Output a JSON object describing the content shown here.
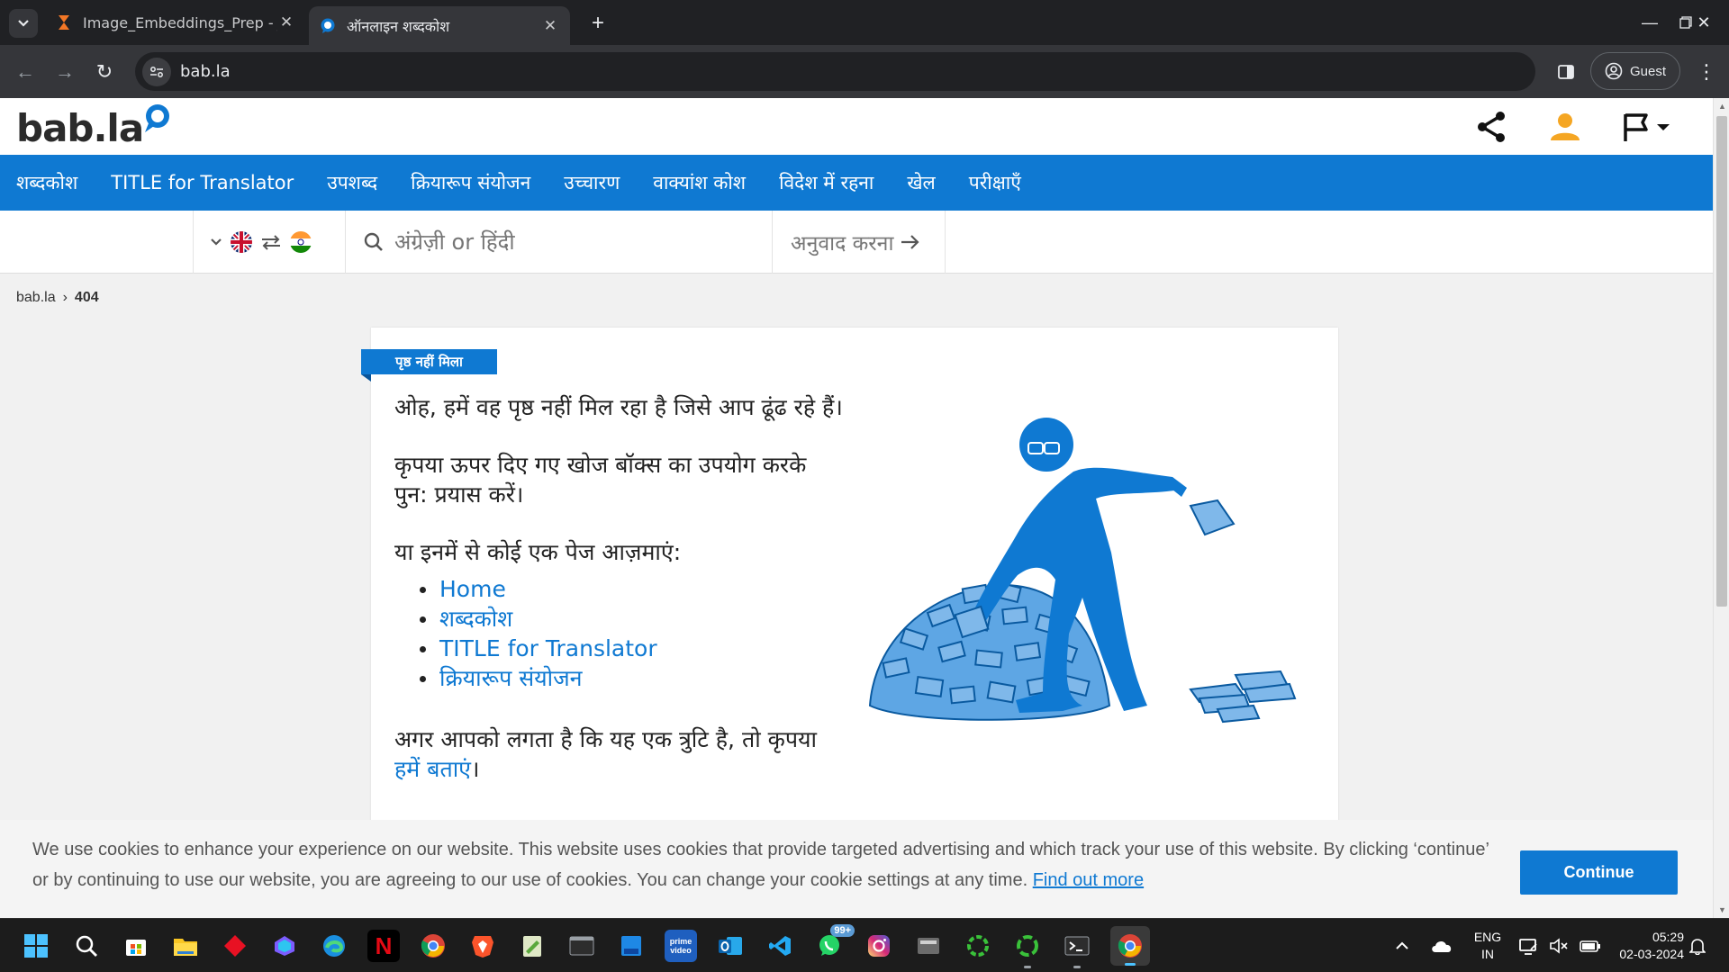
{
  "browser": {
    "tabs": [
      {
        "title": "Image_Embeddings_Prep - Jupy",
        "active": false,
        "icon": "hourglass-icon"
      },
      {
        "title": "ऑनलाइन शब्दकोश",
        "active": true,
        "icon": "babla-favicon"
      }
    ],
    "url": "bab.la",
    "profile_label": "Guest"
  },
  "site": {
    "logo": "bab.la",
    "nav": [
      "शब्दकोश",
      "TITLE for Translator",
      "उपशब्द",
      "क्रियारूप संयोजन",
      "उच्चारण",
      "वाक्यांश कोश",
      "विदेश में रहना",
      "खेल",
      "परीक्षाएँ"
    ],
    "search": {
      "placeholder": "अंग्रेज़ी or हिंदी",
      "translate_label": "अनुवाद करना"
    },
    "breadcrumb": {
      "home": "bab.la",
      "separator": "›",
      "current": "404"
    },
    "error_card": {
      "tag": "पृष्ठ नहीं मिला",
      "para1": "ओह, हमें वह पृष्ठ नहीं मिल रहा है जिसे आप ढूंढ रहे हैं।",
      "para2": "कृपया ऊपर दिए गए खोज बॉक्स का उपयोग करके पुन: प्रयास करें।",
      "list_lead": "या इनमें से कोई एक पेज आज़माएं:",
      "links": [
        "Home",
        "शब्दकोश",
        "TITLE for Translator",
        "क्रियारूप संयोजन"
      ],
      "report_text": "अगर आपको लगता है कि यह एक त्रुटि है, तो कृपया",
      "report_link": "हमें बताएं",
      "report_end": "।"
    },
    "cookie": {
      "text": "We use cookies to enhance your experience on our website. This website uses cookies that provide targeted advertising and which track your use of this website. By clicking ‘continue’ or by continuing to use our website, you are agreeing to our use of cookies. You can change your cookie settings at any time.",
      "link": "Find out more",
      "button": "Continue"
    },
    "colors": {
      "brand": "#0f79d2",
      "accent_orange": "#f5a623"
    }
  },
  "taskbar": {
    "apps": [
      "windows-start-icon",
      "search-icon",
      "store-icon",
      "file-explorer-icon",
      "app-red-icon",
      "copilot-icon",
      "edge-icon",
      "netflix-icon",
      "chrome-icon",
      "brave-icon",
      "notepad-icon",
      "terminal-icon",
      "folder-blue-icon",
      "prime-video-icon",
      "outlook-icon",
      "vscode-icon",
      "whatsapp-icon",
      "instagram-icon",
      "calculator-icon",
      "ring-app-icon",
      "ring-app-2-icon",
      "cmd-icon",
      "chrome-active-icon"
    ],
    "whatsapp_badge": "99+",
    "language": "ENG",
    "region": "IN",
    "time": "05:29",
    "date": "02-03-2024"
  }
}
